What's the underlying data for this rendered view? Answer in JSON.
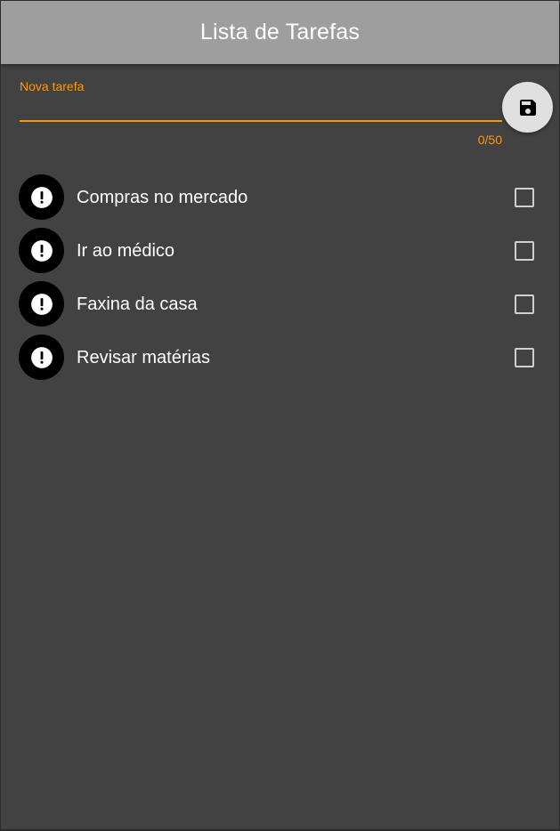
{
  "appbar": {
    "title": "Lista de Tarefas"
  },
  "new_task": {
    "label": "Nova tarefa",
    "value": "",
    "counter": "0/50"
  },
  "save_button": {
    "icon": "save-icon"
  },
  "tasks": [
    {
      "label": "Compras no mercado",
      "icon": "exclamation-icon",
      "checked": false
    },
    {
      "label": "Ir ao médico",
      "icon": "exclamation-icon",
      "checked": false
    },
    {
      "label": "Faxina da casa",
      "icon": "exclamation-icon",
      "checked": false
    },
    {
      "label": "Revisar matérias",
      "icon": "exclamation-icon",
      "checked": false
    }
  ],
  "colors": {
    "appbar": "#9e9e9e",
    "background": "#424242",
    "accent": "#ff9800",
    "fab": "#e0e0e0",
    "avatar": "#000000"
  }
}
